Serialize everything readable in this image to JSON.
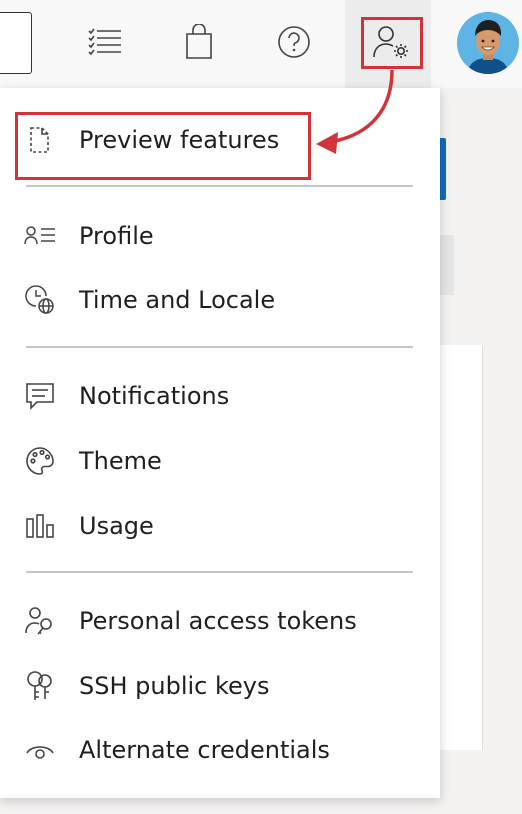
{
  "topbar": {
    "icons": [
      "work-items-list-icon",
      "marketplace-bag-icon",
      "help-icon",
      "user-settings-icon"
    ],
    "avatar": "avatar"
  },
  "menu": {
    "items": [
      {
        "label": "Preview features",
        "icon": "preview-features-icon"
      },
      {
        "label": "Profile",
        "icon": "profile-icon"
      },
      {
        "label": "Time and Locale",
        "icon": "time-locale-icon"
      },
      {
        "label": "Notifications",
        "icon": "notifications-icon"
      },
      {
        "label": "Theme",
        "icon": "theme-palette-icon"
      },
      {
        "label": "Usage",
        "icon": "usage-chart-icon"
      },
      {
        "label": "Personal access tokens",
        "icon": "personal-access-token-icon"
      },
      {
        "label": "SSH public keys",
        "icon": "ssh-keys-icon"
      },
      {
        "label": "Alternate credentials",
        "icon": "alternate-credentials-icon"
      }
    ]
  },
  "colors": {
    "highlight": "#d13438",
    "accent": "#0f6cbd",
    "avatar_bg": "#5fb4e6"
  }
}
